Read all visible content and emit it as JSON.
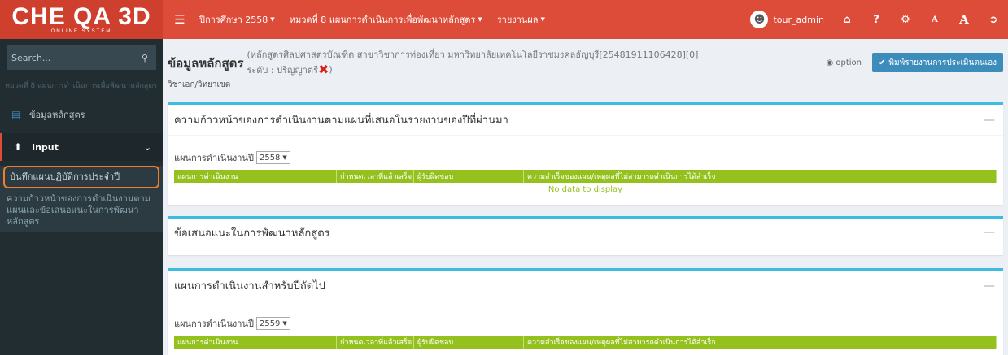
{
  "logo": {
    "main": "CHE QA 3D",
    "sub": "ONLINE SYSTEM"
  },
  "navbar": {
    "menus": [
      {
        "label": "ปีการศึกษา 2558"
      },
      {
        "label": "หมวดที่ 8 แผนการดำเนินการเพื่อพัฒนาหลักสูตร"
      },
      {
        "label": "รายงานผล"
      }
    ],
    "user": "tour_admin",
    "icons": [
      "home-icon",
      "help-icon",
      "settings-icon",
      "font-small-icon",
      "font-large-icon",
      "logout-icon"
    ],
    "font_small": "A",
    "font_large": "A"
  },
  "sidebar": {
    "search_placeholder": "Search...",
    "crumb": "หมวดที่ 8 แผนการดำเนินการเพื่อพัฒนาหลักสูตร",
    "item_course_info": "ข้อมูลหลักสูตร",
    "item_input": "Input",
    "sub_items": [
      "บันทึกแผนปฏิบัติการประจำปี",
      "ความก้าวหน้าของการดำเนินงานตามแผนและข้อเสนอแนะในการพัฒนาหลักสูตร"
    ]
  },
  "header": {
    "title": "ข้อมูลหลักสูตร",
    "desc_line1": "(หลักสูตรศิลปศาสตรบัณฑิต สาขาวิชาการท่องเที่ยว มหาวิทยาลัยเทคโนโลยีราชมงคลธัญบุรี[25481911106428][0]",
    "desc_line2": "ระดับ : ปริญญาตรี",
    "desc_close": ")",
    "subtitle": "วิชาเอก/วิทยาเขต",
    "option": "option",
    "report_button": "พิมพ์รายงานการประเมินตนเอง"
  },
  "sections": [
    {
      "title": "ความก้าวหน้าของการดำเนินงานตามแผนที่เสนอในรายงานของปีที่ผ่านมา",
      "year_label": "แผนการดำเนินงานปี",
      "year": "2558",
      "columns": [
        "แผนการดำเนินงาน",
        "กำหนดเวลาที่แล้วเสร็จ",
        "ผู้รับผิดชอบ",
        "ความสำเร็จของแผน/เหตุผลที่ไม่สามารถดำเนินการได้สำเร็จ"
      ],
      "nodata": "No data to display"
    },
    {
      "title": "ข้อเสนอแนะในการพัฒนาหลักสูตร"
    },
    {
      "title": "แผนการดำเนินงานสำหรับปีถัดไป",
      "year_label": "แผนการดำเนินงานปี",
      "year": "2559",
      "columns": [
        "แผนการดำเนินงาน",
        "กำหนดเวลาที่แล้วเสร็จ",
        "ผู้รับผิดชอบ",
        "ความสำเร็จของแผน/เหตุผลที่ไม่สามารถดำเนินการได้สำเร็จ"
      ]
    }
  ],
  "colors": {
    "navbar": "#dd4b39",
    "logo": "#cf3f2e",
    "sidebar": "#222d32",
    "grid_header": "#95c11f",
    "box_border": "#3cbde0",
    "button": "#3c8dbc",
    "highlight": "#ee7e2d"
  }
}
